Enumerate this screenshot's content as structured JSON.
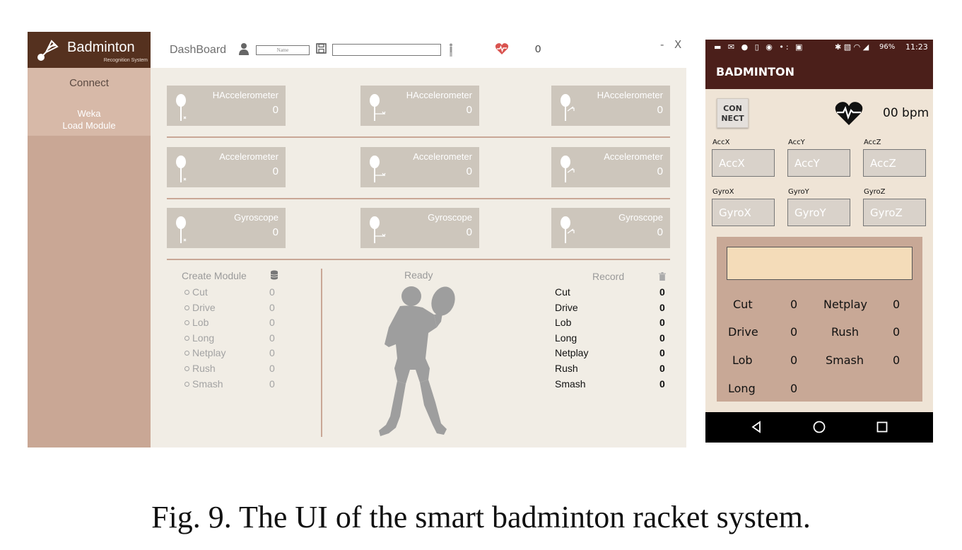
{
  "desktop": {
    "logo": {
      "title": "Badminton",
      "subtitle": "Recognition System",
      "icon": "shuttlecock-icon"
    },
    "sidebar": {
      "connect": "Connect",
      "weka_line1": "Weka",
      "weka_line2": "Load Module"
    },
    "topbar": {
      "title": "DashBoard",
      "name_placeholder": "Name",
      "heart_count": "0",
      "minimize": "-",
      "close": "X"
    },
    "tiles": [
      {
        "label": "HAccelerometer",
        "value": "0",
        "axis": "x"
      },
      {
        "label": "HAccelerometer",
        "value": "0",
        "axis": "y"
      },
      {
        "label": "HAccelerometer",
        "value": "0",
        "axis": "z"
      },
      {
        "label": "Accelerometer",
        "value": "0",
        "axis": "x"
      },
      {
        "label": "Accelerometer",
        "value": "0",
        "axis": "y"
      },
      {
        "label": "Accelerometer",
        "value": "0",
        "axis": "z"
      },
      {
        "label": "Gyroscope",
        "value": "0",
        "axis": "x"
      },
      {
        "label": "Gyroscope",
        "value": "0",
        "axis": "y"
      },
      {
        "label": "Gyroscope",
        "value": "0",
        "axis": "z"
      }
    ],
    "create_module": {
      "title": "Create Module",
      "rows": [
        {
          "label": "Cut",
          "value": "0"
        },
        {
          "label": "Drive",
          "value": "0"
        },
        {
          "label": "Lob",
          "value": "0"
        },
        {
          "label": "Long",
          "value": "0"
        },
        {
          "label": "Netplay",
          "value": "0"
        },
        {
          "label": "Rush",
          "value": "0"
        },
        {
          "label": "Smash",
          "value": "0"
        }
      ]
    },
    "status": "Ready",
    "record": {
      "title": "Record",
      "rows": [
        {
          "label": "Cut",
          "value": "0"
        },
        {
          "label": "Drive",
          "value": "0"
        },
        {
          "label": "Lob",
          "value": "0"
        },
        {
          "label": "Long",
          "value": "0"
        },
        {
          "label": "Netplay",
          "value": "0"
        },
        {
          "label": "Rush",
          "value": "0"
        },
        {
          "label": "Smash",
          "value": "0"
        }
      ]
    }
  },
  "phone": {
    "status_bar": {
      "battery": "96%",
      "time": "11:23"
    },
    "app_title": "BADMINTON",
    "connect_line1": "CON",
    "connect_line2": "NECT",
    "bpm": "00 bpm",
    "acc": [
      {
        "label": "AccX",
        "value": "AccX"
      },
      {
        "label": "AccY",
        "value": "AccY"
      },
      {
        "label": "AccZ",
        "value": "AccZ"
      }
    ],
    "gyro": [
      {
        "label": "GyroX",
        "value": "GyroX"
      },
      {
        "label": "GyroY",
        "value": "GyroY"
      },
      {
        "label": "GyroZ",
        "value": "GyroZ"
      }
    ],
    "counts": [
      {
        "label": "Cut",
        "value": "0"
      },
      {
        "label": "Netplay",
        "value": "0"
      },
      {
        "label": "Drive",
        "value": "0"
      },
      {
        "label": "Rush",
        "value": "0"
      },
      {
        "label": "Lob",
        "value": "0"
      },
      {
        "label": "Smash",
        "value": "0"
      },
      {
        "label": "Long",
        "value": "0"
      }
    ]
  },
  "caption": "Fig. 9.  The UI of the smart badminton racket system.",
  "colors": {
    "sidebar": "#c9a795",
    "logo_bg": "#55311f",
    "tile": "#cdc6bc",
    "phone_bar": "#4b1f1a",
    "heart": "#d9534f"
  }
}
